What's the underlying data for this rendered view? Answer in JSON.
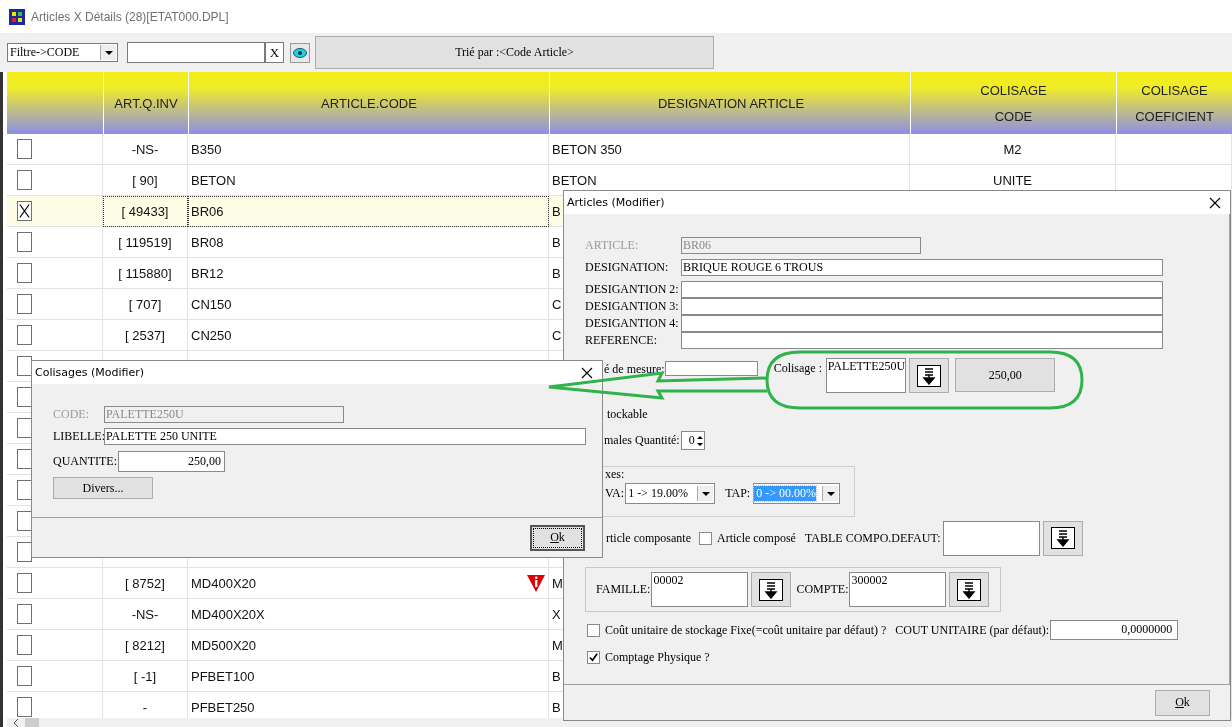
{
  "window": {
    "title": "Articles X Détails (28)[ETAT000.DPL]"
  },
  "toolbar": {
    "filter": "Filtre->CODE",
    "clear": "X",
    "sort_button": "Trié par :<Code Article>"
  },
  "table": {
    "columns": [
      {
        "lines": [
          "ART.Q.INV"
        ]
      },
      {
        "lines": [
          "ARTICLE.CODE"
        ]
      },
      {
        "lines": [
          "DESIGNATION ARTICLE"
        ]
      },
      {
        "lines": [
          "COLISAGE",
          "CODE"
        ]
      },
      {
        "lines": [
          "COLISAGE",
          "COEFICIENT"
        ]
      }
    ],
    "rows": [
      {
        "checked": false,
        "selected": false,
        "qty": "-NS-",
        "code": "B350",
        "designation": "BETON 350",
        "colisage_code": "M2",
        "warning": false
      },
      {
        "checked": false,
        "selected": false,
        "qty": "[ 90]",
        "code": "BETON",
        "designation": "BETON",
        "colisage_code": "UNITE",
        "warning": false
      },
      {
        "checked": true,
        "selected": true,
        "qty": "[ 49433]",
        "code": "BR06",
        "designation": "B",
        "warning": false
      },
      {
        "checked": false,
        "selected": false,
        "qty": "[ 119519]",
        "code": "BR08",
        "designation": "B",
        "warning": false
      },
      {
        "checked": false,
        "selected": false,
        "qty": "[ 115880]",
        "code": "BR12",
        "designation": "B",
        "warning": false
      },
      {
        "checked": false,
        "selected": false,
        "qty": "[ 707]",
        "code": "CN150",
        "designation": "C",
        "warning": false
      },
      {
        "checked": false,
        "selected": false,
        "qty": "[ 2537]",
        "code": "CN250",
        "designation": "C",
        "warning": false
      },
      {
        "checked": false,
        "selected": false
      },
      {
        "checked": false,
        "selected": false
      },
      {
        "checked": false,
        "selected": false
      },
      {
        "checked": false,
        "selected": false
      },
      {
        "checked": false,
        "selected": false
      },
      {
        "checked": false,
        "selected": false
      },
      {
        "checked": false,
        "selected": false
      },
      {
        "checked": false,
        "selected": false,
        "qty": "[ 8752]",
        "code": "MD400X20",
        "designation": "M",
        "warning": true
      },
      {
        "checked": false,
        "selected": false,
        "qty": "-NS-",
        "code": "MD400X20X",
        "designation": "X",
        "warning": false
      },
      {
        "checked": false,
        "selected": false,
        "qty": "[ 8212]",
        "code": "MD500X20",
        "designation": "M",
        "warning": false
      },
      {
        "checked": false,
        "selected": false,
        "qty": "[ -1]",
        "code": "PFBET100",
        "designation": "B",
        "warning": false
      },
      {
        "checked": false,
        "selected": false,
        "qty": "-",
        "code": "PFBET250",
        "designation": "B",
        "warning": false
      }
    ]
  },
  "articles_dialog": {
    "title": "Articles  (Modifier)",
    "fields": [
      {
        "label": "ARTICLE:",
        "value": "BR06",
        "disabled": true
      },
      {
        "label": "DESIGNATION:",
        "value": "BRIQUE ROUGE 6 TROUS",
        "disabled": false
      },
      {
        "label": "DESIGANTION 2:",
        "disabled": false
      },
      {
        "label": "DESIGANTION 3:",
        "disabled": false
      },
      {
        "label": "DESIGANTION 4:",
        "disabled": false
      },
      {
        "label": "REFERENCE:",
        "disabled": false
      }
    ],
    "unit_label": "é de mesure:",
    "colisage": {
      "label": "Colisage :",
      "value": "PALETTE250U",
      "quantity": "250,00"
    },
    "stockable": "tockable",
    "decimals": {
      "label": "males Quantité:",
      "value": "0"
    },
    "taxes": {
      "label": "xes:",
      "tva_label": "VA:",
      "tva": "1 -> 19.00%",
      "tap_label": "TAP:",
      "tap": "0 -> 00.00%"
    },
    "composante": "rticle composante",
    "compose": {
      "label": "Article composé",
      "checked": false
    },
    "table_compo": "TABLE COMPO.DEFAUT:",
    "famille": {
      "label": "FAMILLE:",
      "value": "00002"
    },
    "compte": {
      "label": "COMPTE:",
      "value": "300002"
    },
    "fixed_cost": {
      "label": "Coût unitaire de stockage Fixe(=coût unitaire par défaut) ?",
      "checked": false
    },
    "unit_cost": {
      "label": "COUT UNITAIRE (par défaut):",
      "value": "0,0000000"
    },
    "physical_count": {
      "label": "Comptage Physique ?",
      "checked": true
    },
    "ok": "Ok"
  },
  "colisages_dialog": {
    "title": "Colisages  (Modifier)",
    "fields": [
      {
        "label": "CODE:",
        "value": "PALETTE250U",
        "disabled": true
      },
      {
        "label": "LIBELLE:",
        "value": "PALETTE 250 UNITE",
        "disabled": false
      }
    ],
    "quantity": {
      "label": "QUANTITE:",
      "value": "250,00"
    },
    "divers": "Divers...",
    "ok": "Ok"
  }
}
